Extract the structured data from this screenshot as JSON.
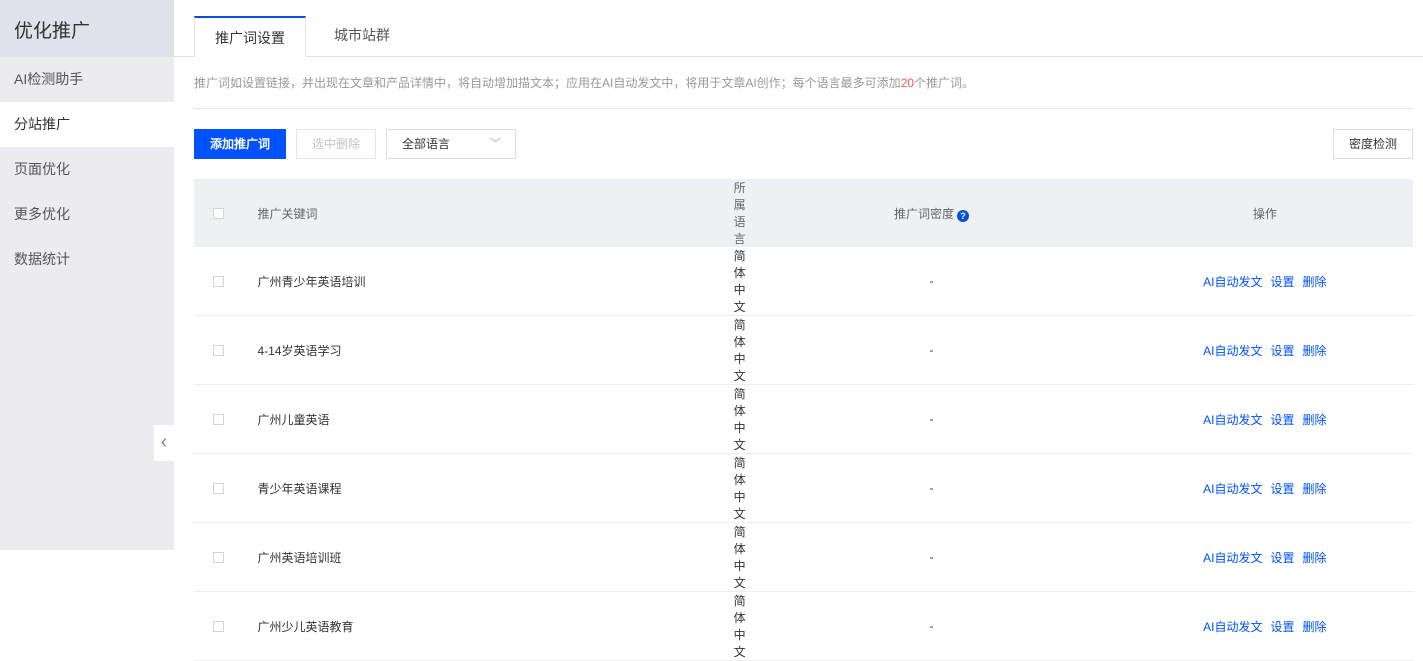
{
  "sidebar": {
    "title": "优化推广",
    "items": [
      "AI检测助手",
      "分站推广",
      "页面优化",
      "更多优化",
      "数据统计"
    ],
    "active": 1
  },
  "tabs": [
    "推广词设置",
    "城市站群"
  ],
  "desc": {
    "before": "推广词如设置链接，并出现在文章和产品详情中，将自动增加描文本；应用在AI自动发文中，将用于文章AI创作；每个语言最多可添加",
    "limit": "20",
    "after": "个推广词。"
  },
  "toolbar": {
    "add": "添加推广词",
    "delete_selected": "选中删除",
    "language_select": "全部语言",
    "density_check": "密度检测"
  },
  "table": {
    "headers": [
      "推广关键词",
      "所属语言",
      "推广词密度",
      "操作"
    ],
    "actions": [
      "AI自动发文",
      "设置",
      "删除"
    ],
    "rows": [
      {
        "keyword": "广州青少年英语培训",
        "lang": "简体中文",
        "density": "-"
      },
      {
        "keyword": "4-14岁英语学习",
        "lang": "简体中文",
        "density": "-"
      },
      {
        "keyword": "广州儿童英语",
        "lang": "简体中文",
        "density": "-"
      },
      {
        "keyword": "青少年英语课程",
        "lang": "简体中文",
        "density": "-"
      },
      {
        "keyword": "广州英语培训班",
        "lang": "简体中文",
        "density": "-"
      },
      {
        "keyword": "广州少儿英语教育",
        "lang": "简体中文",
        "density": "-"
      }
    ]
  }
}
